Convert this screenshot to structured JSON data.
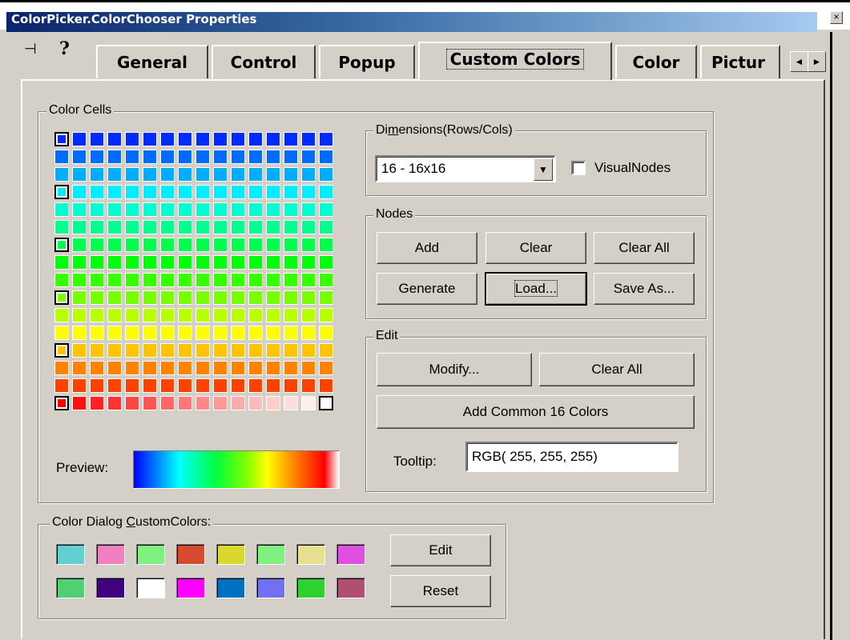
{
  "window": {
    "title": "ColorPicker.ColorChooser Properties",
    "close_glyph": "×"
  },
  "toolbar": {
    "pin_icon": "pin-icon",
    "help_icon": "help-icon",
    "pin_glyph": "⊣",
    "help_glyph": "?"
  },
  "tabs": [
    {
      "label": "General",
      "active": false
    },
    {
      "label": "Control",
      "active": false
    },
    {
      "label": "Popup",
      "active": false
    },
    {
      "label": "Custom Colors",
      "active": true
    },
    {
      "label": "Color",
      "active": false
    },
    {
      "label": "Pictur",
      "active": false
    }
  ],
  "tab_scroll": {
    "left_glyph": "◄",
    "right_glyph": "►"
  },
  "color_cells": {
    "label": "Color Cells",
    "rows": 16,
    "cols": 16,
    "preview_label": "Preview:"
  },
  "dimensions": {
    "label_pre": "Di",
    "label_ul": "m",
    "label_post": "ensions(Rows/Cols)",
    "selected": "16 - 16x16",
    "visual_nodes_label": "VisualNodes",
    "visual_nodes_checked": false
  },
  "nodes": {
    "label": "Nodes",
    "add": "Add",
    "clear": "Clear",
    "clear_all": "Clear All",
    "generate": "Generate",
    "load": "Load...",
    "save_as": "Save As..."
  },
  "edit": {
    "label": "Edit",
    "modify": "Modify...",
    "clear_all": "Clear All",
    "add_common": "Add Common 16 Colors",
    "tooltip_label": "Tooltip:",
    "tooltip_value": "RGB( 255, 255, 255)"
  },
  "dialog_colors": {
    "label_pre": "Color Dialog ",
    "label_ul": "C",
    "label_post": "ustomColors:",
    "swatches": [
      "#60d0d0",
      "#f080c0",
      "#80f080",
      "#d84a30",
      "#d8d830",
      "#80f080",
      "#e8e090",
      "#e050e0",
      "#50d070",
      "#400080",
      "#ffffff",
      "#ff00ff",
      "#0070c0",
      "#7070f0",
      "#30d030",
      "#b05070"
    ],
    "edit": "Edit",
    "reset": "Reset"
  }
}
